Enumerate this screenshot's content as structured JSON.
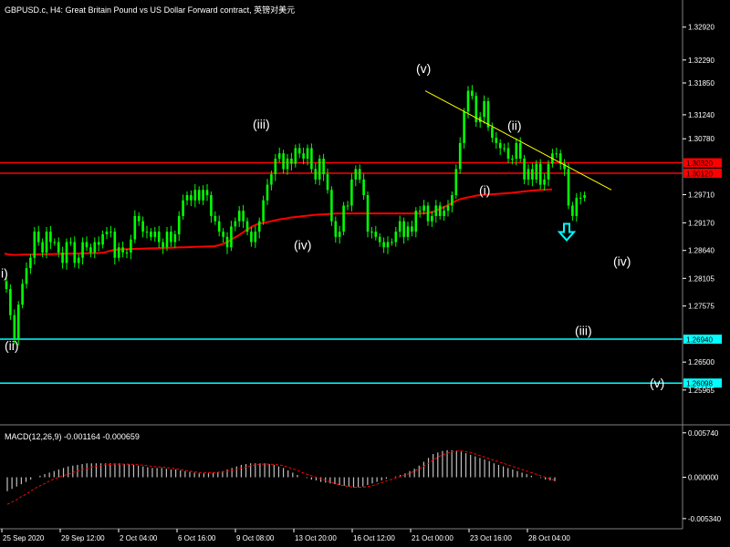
{
  "header": {
    "title": "GBPUSD.c, H4:  Great Britain Pound vs US Dollar Forward contract, 英镑对美元"
  },
  "colors": {
    "background": "#000000",
    "candle": "#00ff00",
    "ma": "#ff0000",
    "resistance": "#ff0000",
    "support": "#00ffff",
    "trendline": "#ffff00",
    "wave_label": "#ffffff",
    "arrow": "#00ffff",
    "macd_hist": "#c0c0c0",
    "macd_signal": "#ff0000",
    "axis_text": "#ffffff",
    "separator": "#808080"
  },
  "chart_data": [
    {
      "type": "candlestick",
      "title": "GBPUSD.c, H4:  Great Britain Pound vs US Dollar Forward contract, 英镑对美元",
      "ylim": [
        1.2535,
        1.333
      ],
      "y_ticks": [
        "1.32920",
        "1.32290",
        "1.31850",
        "1.31240",
        "1.30780",
        "1.29710",
        "1.29170",
        "1.28640",
        "1.28105",
        "1.27575",
        "1.26500",
        "1.25965"
      ],
      "x_ticks": [
        "25 Sep 2020",
        "29 Sep 12:00",
        "2 Oct 04:00",
        "6 Oct 16:00",
        "9 Oct 08:00",
        "13 Oct 20:00",
        "16 Oct 12:00",
        "21 Oct 00:00",
        "23 Oct 16:00",
        "28 Oct 04:00"
      ],
      "series": [
        {
          "kind": "ohlc",
          "close": [
            1.279,
            1.274,
            1.2695,
            1.276,
            1.28,
            1.283,
            1.285,
            1.29,
            1.288,
            1.286,
            1.29,
            1.288,
            1.288,
            1.286,
            1.284,
            1.288,
            1.288,
            1.284,
            1.285,
            1.288,
            1.287,
            1.286,
            1.288,
            1.2875,
            1.2895,
            1.29,
            1.29,
            1.285,
            1.287,
            1.286,
            1.286,
            1.2885,
            1.293,
            1.292,
            1.29,
            1.29,
            1.289,
            1.29,
            1.288,
            1.287,
            1.29,
            1.288,
            1.2895,
            1.293,
            1.296,
            1.297,
            1.296,
            1.298,
            1.296,
            1.298,
            1.297,
            1.293,
            1.292,
            1.29,
            1.289,
            1.287,
            1.291,
            1.292,
            1.294,
            1.292,
            1.29,
            1.288,
            1.29,
            1.292,
            1.296,
            1.299,
            1.301,
            1.304,
            1.305,
            1.302,
            1.304,
            1.303,
            1.306,
            1.305,
            1.304,
            1.306,
            1.302,
            1.3,
            1.304,
            1.301,
            1.298,
            1.292,
            1.289,
            1.29,
            1.295,
            1.295,
            1.3,
            1.302,
            1.3,
            1.297,
            1.29,
            1.29,
            1.289,
            1.288,
            1.287,
            1.288,
            1.288,
            1.29,
            1.292,
            1.289,
            1.291,
            1.29,
            1.294,
            1.294,
            1.295,
            1.292,
            1.293,
            1.295,
            1.293,
            1.294,
            1.295,
            1.297,
            1.302,
            1.307,
            1.313,
            1.317,
            1.316,
            1.311,
            1.312,
            1.315,
            1.31,
            1.308,
            1.307,
            1.306,
            1.306,
            1.304,
            1.304,
            1.307,
            1.304,
            1.3,
            1.302,
            1.3,
            1.303,
            1.299,
            1.3,
            1.303,
            1.305,
            1.305,
            1.303,
            1.302,
            1.295,
            1.293,
            1.2965,
            1.2965,
            1.297
          ]
        },
        {
          "kind": "line",
          "values": [
            1.2858,
            1.2856,
            1.28555,
            1.28557,
            1.28559,
            1.28561,
            1.28563,
            1.28565,
            1.28567,
            1.28569,
            1.28571,
            1.28573,
            1.28575,
            1.28577,
            1.28579,
            1.28581,
            1.28583,
            1.28585,
            1.28587,
            1.28589,
            1.28591,
            1.286,
            1.2863,
            1.2865,
            1.2866,
            1.28663,
            1.28666,
            1.28669,
            1.28672,
            1.28675,
            1.28678,
            1.28681,
            1.28684,
            1.28687,
            1.2869,
            1.28693,
            1.28696,
            1.28699,
            1.28702,
            1.28705,
            1.28708,
            1.28711,
            1.28714,
            1.28717,
            1.2872,
            1.2874,
            1.2877,
            1.2881,
            1.2887,
            1.2892,
            1.2898,
            1.2904,
            1.291,
            1.2914,
            1.2916,
            1.2918,
            1.292,
            1.2922,
            1.2924,
            1.2925,
            1.2927,
            1.2928,
            1.2929,
            1.293,
            1.2931,
            1.2932,
            1.29326,
            1.29332,
            1.29338,
            1.29344,
            1.2935,
            1.2935,
            1.2935,
            1.2935,
            1.2935,
            1.2935,
            1.2935,
            1.2935,
            1.2935,
            1.2935,
            1.2935,
            1.2935,
            1.2935,
            1.2935,
            1.2935,
            1.2935,
            1.2935,
            1.2935,
            1.2935,
            1.2936,
            1.2938,
            1.2942,
            1.2946,
            1.295,
            1.2955,
            1.296,
            1.2963,
            1.2965,
            1.2967,
            1.2969,
            1.297,
            1.29707,
            1.29713,
            1.2972,
            1.29727,
            1.29733,
            1.2974,
            1.2975,
            1.2976,
            1.2977,
            1.2978,
            1.2979,
            1.29795,
            1.298,
            1.29805,
            1.2981
          ]
        }
      ],
      "hlines": [
        {
          "value": 1.3032,
          "label": "1.30320",
          "color": "#ff0000"
        },
        {
          "value": 1.3012,
          "label": "1.30120",
          "color": "#ff0000"
        },
        {
          "value": 1.2694,
          "label": "1.26940",
          "color": "#00ffff"
        },
        {
          "value": 1.26098,
          "label": "1.26098",
          "color": "#00ffff"
        }
      ],
      "trendline": {
        "from": [
          466,
          1.317
        ],
        "to": [
          670,
          1.298
        ],
        "color": "#ffff00"
      },
      "wave_labels": [
        {
          "text": "i)",
          "x": 1,
          "y": 1.2812
        },
        {
          "text": "(ii)",
          "x": 5,
          "y": 1.2673
        },
        {
          "text": "(iii)",
          "x": 277,
          "y": 1.3098
        },
        {
          "text": "(iv)",
          "x": 322,
          "y": 1.2866
        },
        {
          "text": "(v)",
          "x": 456,
          "y": 1.3204
        },
        {
          "text": "(ii)",
          "x": 556,
          "y": 1.3095
        },
        {
          "text": "(i)",
          "x": 525,
          "y": 1.2971
        },
        {
          "text": "(iv)",
          "x": 672,
          "y": 1.2835
        },
        {
          "text": "(iii)",
          "x": 630,
          "y": 1.2702
        },
        {
          "text": "(v)",
          "x": 712,
          "y": 1.2601
        }
      ],
      "arrow": {
        "direction": "down",
        "x": 621,
        "y": 1.2915
      }
    },
    {
      "type": "bar",
      "title": "MACD(12,26,9) -0.001164 -0.000659",
      "ylim": [
        -0.0063,
        0.0063
      ],
      "y_ticks": [
        "0.005740",
        "0.000000",
        "-0.005340"
      ],
      "series": [
        {
          "name": "macd",
          "values": [
            -0.0018,
            -0.0015,
            -0.0012,
            -0.0009,
            -0.0006,
            -0.0003,
            0.0,
            0.0002,
            0.0004,
            0.0006,
            0.0008,
            0.001,
            0.0012,
            0.0014,
            0.0015,
            0.0016,
            0.0017,
            0.0018,
            0.0018,
            0.0018,
            0.0018,
            0.0018,
            0.0018,
            0.0018,
            0.0018,
            0.0017,
            0.0017,
            0.0016,
            0.0015,
            0.0014,
            0.0013,
            0.0012,
            0.0012,
            0.0012,
            0.0011,
            0.001,
            0.001,
            0.0009,
            0.0008,
            0.0007,
            0.0006,
            0.0005,
            0.0005,
            0.0005,
            0.0006,
            0.0007,
            0.0008,
            0.001,
            0.0012,
            0.0014,
            0.0016,
            0.0017,
            0.0018,
            0.0018,
            0.0018,
            0.0018,
            0.0017,
            0.0016,
            0.0014,
            0.0012,
            0.0009,
            0.0006,
            0.0003,
            0.0,
            -0.0001,
            -0.0003,
            -0.0004,
            -0.0006,
            -0.0007,
            -0.0008,
            -0.0009,
            -0.001,
            -0.0011,
            -0.0012,
            -0.0013,
            -0.0013,
            -0.0012,
            -0.001,
            -0.0008,
            -0.0006,
            -0.0004,
            -0.0002,
            0.0,
            0.0001,
            0.0003,
            0.0005,
            0.0008,
            0.0011,
            0.0015,
            0.002,
            0.0025,
            0.003,
            0.0032,
            0.0034,
            0.0035,
            0.0035,
            0.0034,
            0.0033,
            0.0031,
            0.0029,
            0.0027,
            0.0025,
            0.0023,
            0.0021,
            0.0018,
            0.0016,
            0.0014,
            0.0012,
            0.001,
            0.0008,
            0.0006,
            0.0004,
            0.0002,
            0.0,
            -0.0001,
            -0.0003,
            -0.0004,
            -0.0005
          ]
        },
        {
          "name": "signal",
          "values": [
            -0.0035,
            -0.0032,
            -0.0029,
            -0.0025,
            -0.0022,
            -0.0018,
            -0.0014,
            -0.0011,
            -0.0008,
            -0.0005,
            -0.0002,
            0.0,
            0.0002,
            0.0004,
            0.0006,
            0.0008,
            0.001,
            0.00115,
            0.0013,
            0.0014,
            0.0015,
            0.0016,
            0.00165,
            0.0017,
            0.0017,
            0.0017,
            0.0017,
            0.00165,
            0.0016,
            0.00155,
            0.0015,
            0.0014,
            0.00135,
            0.0013,
            0.00125,
            0.0012,
            0.0011,
            0.001,
            0.0009,
            0.0008,
            0.0007,
            0.0006,
            0.0006,
            0.0006,
            0.0006,
            0.00065,
            0.0007,
            0.0008,
            0.0009,
            0.001,
            0.0012,
            0.0013,
            0.0015,
            0.0016,
            0.0017,
            0.0017,
            0.0017,
            0.00165,
            0.0016,
            0.0015,
            0.0013,
            0.0011,
            0.0009,
            0.0006,
            0.0004,
            0.0002,
            0.0,
            -0.0002,
            -0.0004,
            -0.0006,
            -0.0008,
            -0.001,
            -0.0011,
            -0.0012,
            -0.0013,
            -0.0013,
            -0.0013,
            -0.0012,
            -0.0011,
            -0.0009,
            -0.0007,
            -0.0005,
            -0.0003,
            -0.0001,
            0.0001,
            0.0003,
            0.0005,
            0.0008,
            0.0011,
            0.0014,
            0.0018,
            0.0022,
            0.0026,
            0.0029,
            0.0031,
            0.0033,
            0.0034,
            0.0034,
            0.0033,
            0.0032,
            0.003,
            0.0028,
            0.0026,
            0.0024,
            0.0022,
            0.002,
            0.0018,
            0.0016,
            0.0014,
            0.0012,
            0.001,
            0.0008,
            0.0006,
            0.0004,
            0.0002,
            0.0,
            -0.0002,
            -0.0004
          ]
        }
      ]
    }
  ]
}
